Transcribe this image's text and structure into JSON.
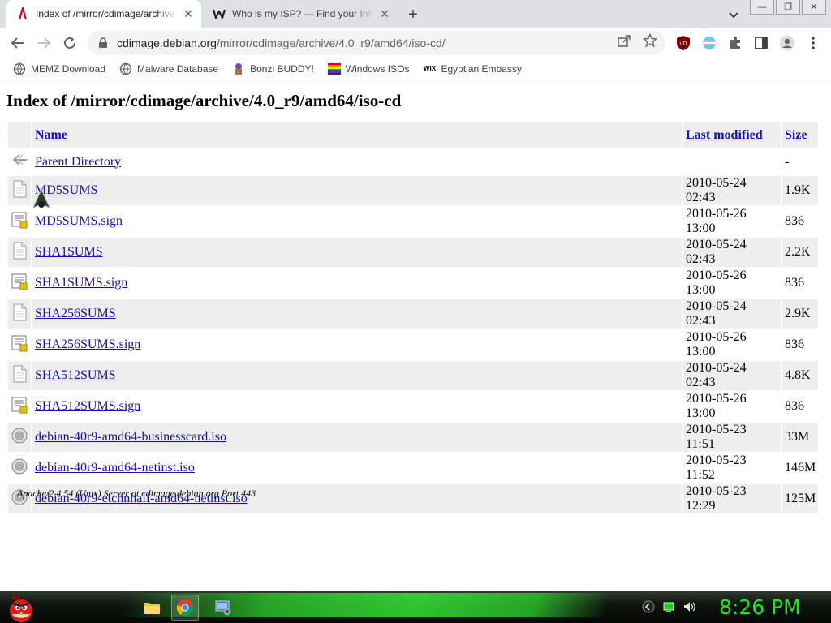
{
  "browser": {
    "tabs": [
      {
        "title": "Index of /mirror/cdimage/archive",
        "favicon": "debian-swirl-icon",
        "active": true
      },
      {
        "title": "Who is my ISP? — Find your Inte",
        "favicon": "w-logo-icon",
        "active": false
      }
    ],
    "window_controls": {
      "minimize": "—",
      "restore": "❐",
      "close": "✕"
    },
    "url_host": "cdimage.debian.org",
    "url_path": "/mirror/cdimage/archive/4.0_r9/amd64/iso-cd/",
    "extensions": [
      "ublock-icon",
      "trans-flag-icon",
      "puzzle-icon",
      "sidepanel-icon",
      "profile-icon",
      "kebab-menu-icon"
    ],
    "extension_labels": {
      "ublock": "uD"
    }
  },
  "bookmarks": [
    {
      "label": "MEMZ Download",
      "icon": "globe-icon"
    },
    {
      "label": "Malware Database",
      "icon": "globe-icon"
    },
    {
      "label": "Bonzi BUDDY!",
      "icon": "bonzi-icon"
    },
    {
      "label": "Windows ISOs",
      "icon": "rainbow-icon"
    },
    {
      "label": "Egyptian Embassy",
      "icon": "wix-icon",
      "icon_text": "WIX"
    }
  ],
  "page": {
    "heading": "Index of /mirror/cdimage/archive/4.0_r9/amd64/iso-cd",
    "columns": {
      "name": "Name",
      "modified": "Last modified",
      "size": "Size"
    },
    "rows": [
      {
        "name": "Parent Directory",
        "modified": "",
        "size": "-",
        "icon": "back-arrow-icon"
      },
      {
        "name": "MD5SUMS",
        "modified": "2010-05-24 02:43",
        "size": "1.9K",
        "icon": "text-file-icon"
      },
      {
        "name": "MD5SUMS.sign",
        "modified": "2010-05-26 13:00",
        "size": "836",
        "icon": "signature-file-icon"
      },
      {
        "name": "SHA1SUMS",
        "modified": "2010-05-24 02:43",
        "size": "2.2K",
        "icon": "text-file-icon"
      },
      {
        "name": "SHA1SUMS.sign",
        "modified": "2010-05-26 13:00",
        "size": "836",
        "icon": "signature-file-icon"
      },
      {
        "name": "SHA256SUMS",
        "modified": "2010-05-24 02:43",
        "size": "2.9K",
        "icon": "text-file-icon"
      },
      {
        "name": "SHA256SUMS.sign",
        "modified": "2010-05-26 13:00",
        "size": "836",
        "icon": "signature-file-icon"
      },
      {
        "name": "SHA512SUMS",
        "modified": "2010-05-24 02:43",
        "size": "4.8K",
        "icon": "text-file-icon"
      },
      {
        "name": "SHA512SUMS.sign",
        "modified": "2010-05-26 13:00",
        "size": "836",
        "icon": "signature-file-icon"
      },
      {
        "name": "debian-40r9-amd64-businesscard.iso",
        "modified": "2010-05-23 11:51",
        "size": "33M",
        "icon": "disc-icon"
      },
      {
        "name": "debian-40r9-amd64-netinst.iso",
        "modified": "2010-05-23 11:52",
        "size": "146M",
        "icon": "disc-icon"
      },
      {
        "name": "debian-40r9-etchnhalf-amd64-netinst.iso",
        "modified": "2010-05-23 12:29",
        "size": "125M",
        "icon": "disc-icon"
      }
    ],
    "footer": "Apache/2.4.54 (Unix) Server at cdimage.debian.org Port 443"
  },
  "taskbar": {
    "items": [
      "angry-bird-start-icon",
      "file-explorer-icon",
      "chrome-icon",
      "control-panel-icon"
    ],
    "tray": [
      "network-icon",
      "battery-icon",
      "volume-icon"
    ],
    "clock": "8:26 PM",
    "accent": "#1de91d"
  },
  "colors": {
    "link": "#1a0dab",
    "row_alt": "#eeeeee",
    "tabstrip": "#dee1e6"
  }
}
